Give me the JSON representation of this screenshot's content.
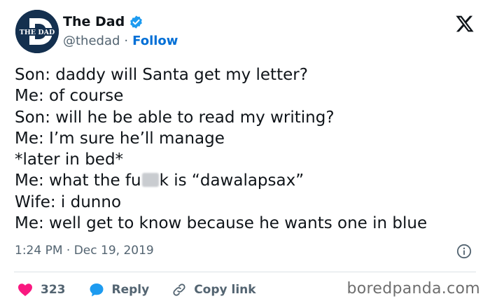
{
  "author": {
    "display_name": "The Dad",
    "handle": "@thedad",
    "separator": "·",
    "follow_label": "Follow",
    "avatar_text": "THE DAD",
    "avatar_letter": "D"
  },
  "tweet": {
    "lines": [
      "Son: daddy will Santa get my letter?",
      "Me: of course",
      "Son: will he be able to read my writing?",
      "Me: I’m sure he’ll manage",
      "*later in bed*",
      "Me: what the fu",
      "Wife: i dunno",
      "Me: well get to know because he wants one in blue"
    ],
    "censored_line_suffix": "k is “dawalapsax”",
    "timestamp": "1:24 PM · Dec 19, 2019"
  },
  "actions": {
    "like_count": "323",
    "reply_label": "Reply",
    "copy_link_label": "Copy link"
  },
  "watermark": "boredpanda.com",
  "colors": {
    "accent": "#1d9bf0",
    "like": "#f91880",
    "text": "#0f1419",
    "muted": "#536471"
  },
  "icons": {
    "verified": "verified-badge-icon",
    "close": "x-logo-icon",
    "info": "info-icon",
    "like": "heart-icon",
    "reply": "speech-bubble-icon",
    "copy_link": "link-icon"
  }
}
